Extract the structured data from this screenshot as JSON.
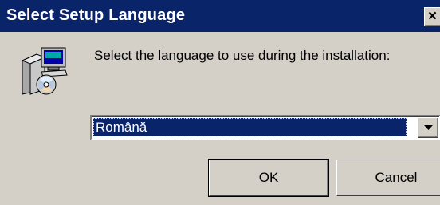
{
  "window": {
    "title": "Select Setup Language",
    "close_label": "×"
  },
  "main": {
    "prompt": "Select the language to use during the installation:",
    "icon": "setup-installer-icon"
  },
  "language_select": {
    "selected": "Română"
  },
  "buttons": {
    "ok_label": "OK",
    "cancel_label": "Cancel"
  },
  "colors": {
    "titlebar": "#0a246a",
    "window": "#d4d0c8",
    "selection": "#0a246a"
  }
}
